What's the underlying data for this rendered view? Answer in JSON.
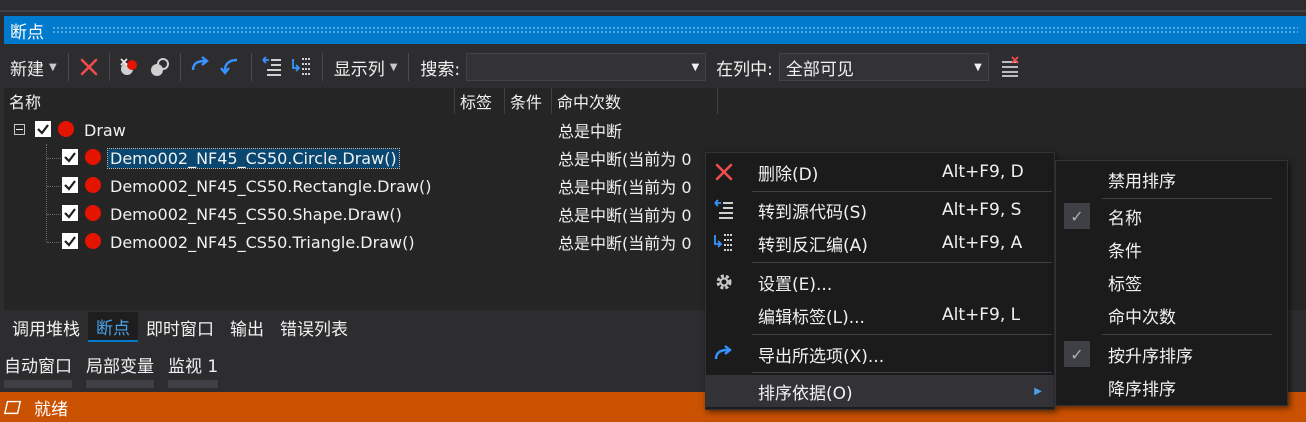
{
  "window": {
    "title": "断点"
  },
  "toolbar": {
    "new_label": "新建",
    "columns_label": "显示列",
    "search_label": "搜索:",
    "search_value": "",
    "incolumn_label": "在列中:",
    "incolumn_value": "全部可见"
  },
  "grid": {
    "columns": [
      "名称",
      "标签",
      "条件",
      "命中次数"
    ],
    "parent": {
      "name": "Draw",
      "hit_count": "总是中断",
      "checked": true
    },
    "rows": [
      {
        "name": "Demo002_NF45_CS50.Circle.Draw()",
        "hit_count": "总是中断(当前为 0",
        "selected": true
      },
      {
        "name": "Demo002_NF45_CS50.Rectangle.Draw()",
        "hit_count": "总是中断(当前为 0",
        "selected": false
      },
      {
        "name": "Demo002_NF45_CS50.Shape.Draw()",
        "hit_count": "总是中断(当前为 0",
        "selected": false
      },
      {
        "name": "Demo002_NF45_CS50.Triangle.Draw()",
        "hit_count": "总是中断(当前为 0",
        "selected": false
      }
    ]
  },
  "tabs_bottom": [
    {
      "label": "调用堆栈",
      "active": false
    },
    {
      "label": "断点",
      "active": true
    },
    {
      "label": "即时窗口",
      "active": false
    },
    {
      "label": "输出",
      "active": false
    },
    {
      "label": "错误列表",
      "active": false
    }
  ],
  "tabs_auto": [
    {
      "label": "自动窗口"
    },
    {
      "label": "局部变量"
    },
    {
      "label": "监视 1"
    }
  ],
  "status": {
    "text": "就绪"
  },
  "context_menu": {
    "items": [
      {
        "label": "删除(D)",
        "shortcut": "Alt+F9, D",
        "icon": "delete-icon"
      },
      {
        "label": "转到源代码(S)",
        "shortcut": "Alt+F9, S",
        "icon": "goto-source-icon"
      },
      {
        "label": "转到反汇编(A)",
        "shortcut": "Alt+F9, A",
        "icon": "goto-disassembly-icon"
      },
      {
        "label": "设置(E)...",
        "shortcut": "",
        "icon": "gear-icon"
      },
      {
        "label": "编辑标签(L)...",
        "shortcut": "Alt+F9, L",
        "icon": ""
      },
      {
        "label": "导出所选项(X)...",
        "shortcut": "",
        "icon": "export-icon"
      },
      {
        "label": "排序依据(O)",
        "shortcut": "",
        "icon": ""
      }
    ]
  },
  "sort_submenu": {
    "items": [
      {
        "label": "禁用排序",
        "checked": false
      },
      {
        "label": "名称",
        "checked": true
      },
      {
        "label": "条件",
        "checked": false
      },
      {
        "label": "标签",
        "checked": false
      },
      {
        "label": "命中次数",
        "checked": false
      },
      {
        "label": "按升序排序",
        "checked": true
      },
      {
        "label": "降序排序",
        "checked": false
      }
    ],
    "check_glyph": "✓"
  },
  "colors": {
    "accent": "#007acc",
    "status_bar": "#ca5100",
    "breakpoint": "#e51400",
    "selection": "#094771"
  }
}
